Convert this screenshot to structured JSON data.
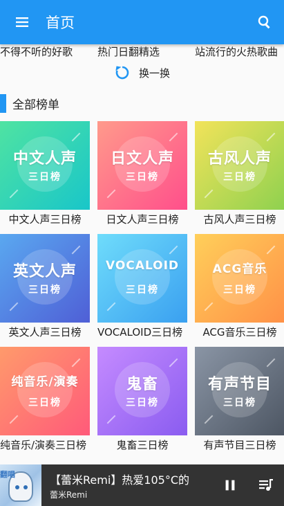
{
  "appbar": {
    "title": "首页",
    "menu_icon": "menu-icon",
    "search_icon": "search-icon",
    "color": "#2196f3"
  },
  "previous_row": {
    "captions": [
      {
        "line1": "…",
        "line2": "不得不听的好歌"
      },
      {
        "line1": "…",
        "line2": "热门日翻精选"
      },
      {
        "line1": "…",
        "line2": "站流行的火热歌曲"
      }
    ]
  },
  "refresh": {
    "label": "换一换",
    "icon": "refresh-icon"
  },
  "section": {
    "title": "全部榜单"
  },
  "charts": [
    {
      "cover_title": "中文人声",
      "cover_sub": "三日榜",
      "caption": "中文人声三日榜",
      "color_a": "#4fe3a2",
      "color_b": "#19c6c9"
    },
    {
      "cover_title": "日文人声",
      "cover_sub": "三日榜",
      "caption": "日文人声三日榜",
      "color_a": "#ff9a8b",
      "color_b": "#ff4f8b"
    },
    {
      "cover_title": "古风人声",
      "cover_sub": "三日榜",
      "caption": "古风人声三日榜",
      "color_a": "#f2e35a",
      "color_b": "#8fd14f"
    },
    {
      "cover_title": "英文人声",
      "cover_sub": "三日榜",
      "caption": "英文人声三日榜",
      "color_a": "#5aa8f0",
      "color_b": "#4f5fd6"
    },
    {
      "cover_title": "VOCALOID",
      "cover_sub": "三日榜",
      "caption": "VOCALOID三日榜",
      "color_a": "#6fdcfb",
      "color_b": "#3aa0f0"
    },
    {
      "cover_title": "ACG音乐",
      "cover_sub": "三日榜",
      "caption": "ACG音乐三日榜",
      "color_a": "#ffcf5a",
      "color_b": "#ff9147"
    },
    {
      "cover_title": "纯音乐/演奏",
      "cover_sub": "三日榜",
      "caption": "纯音乐/演奏三日榜",
      "color_a": "#ff9a6b",
      "color_b": "#ff5a7a"
    },
    {
      "cover_title": "鬼畜",
      "cover_sub": "三日榜",
      "caption": "鬼畜三日榜",
      "color_a": "#c58bff",
      "color_b": "#8a5cf0"
    },
    {
      "cover_title": "有声节目",
      "cover_sub": "三日榜",
      "caption": "有声节目三日榜",
      "color_a": "#8a95a5",
      "color_b": "#4d5663"
    }
  ],
  "player": {
    "song": "【蕾米Remi】热爱105°C的",
    "artist": "蕾米Remi",
    "art_tag": "翻唱",
    "pause_icon": "pause-icon",
    "playlist_icon": "playlist-icon"
  }
}
